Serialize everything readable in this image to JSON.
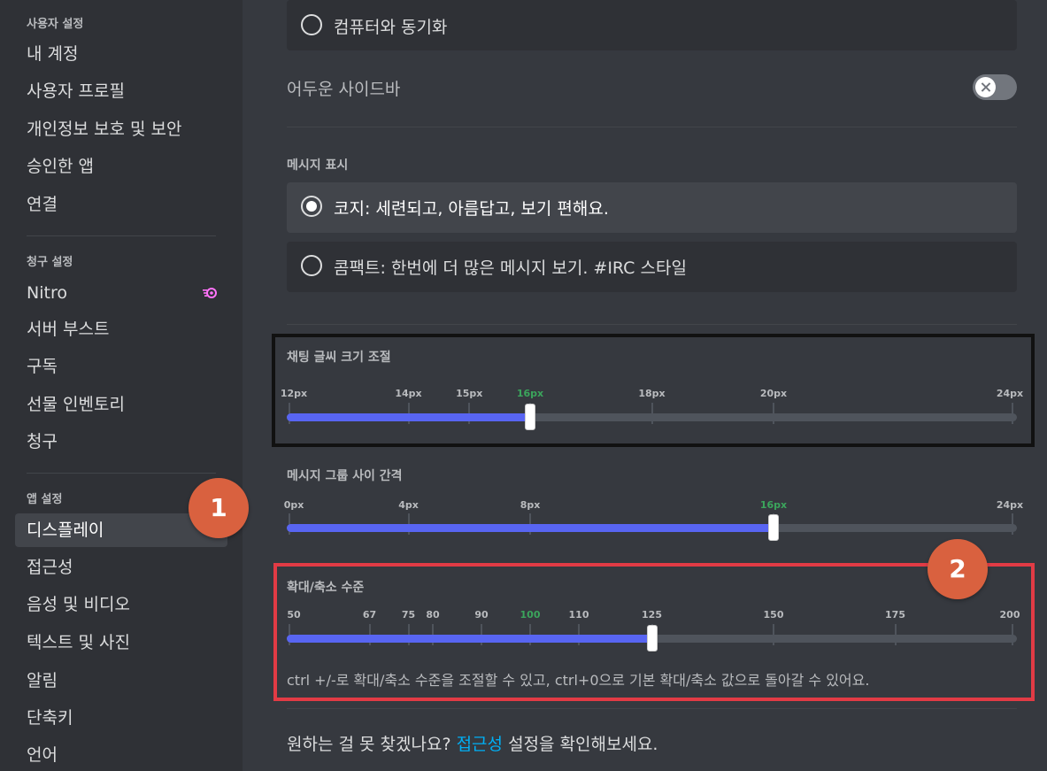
{
  "sidebar": {
    "user_settings_header": "사용자 설정",
    "user_items": [
      "내 계정",
      "사용자 프로필",
      "개인정보 보호 및 보안",
      "승인한 앱",
      "연결"
    ],
    "billing_header": "청구 설정",
    "billing_items": [
      "Nitro",
      "서버 부스트",
      "구독",
      "선물 인벤토리",
      "청구"
    ],
    "app_header": "앱 설정",
    "app_items": [
      "디스플레이",
      "접근성",
      "음성 및 비디오",
      "텍스트 및 사진",
      "알림",
      "단축키",
      "언어"
    ],
    "selected_item": "디스플레이",
    "nitro_icon": "nitro-boost-icon"
  },
  "main": {
    "sync_option": "컴퓨터와 동기화",
    "dark_sidebar_label": "어두운 사이드바",
    "dark_sidebar_enabled": false,
    "message_display_label": "메시지 표시",
    "cozy_option": "코지: 세련되고, 아름답고, 보기 편해요.",
    "compact_option": "콤팩트: 한번에 더 많은 메시지 보기. #IRC 스타일",
    "font_scaling": {
      "label": "채팅 글씨 크기 조절",
      "ticks": [
        "12px",
        "14px",
        "15px",
        "16px",
        "18px",
        "20px",
        "24px"
      ],
      "tick_values": [
        12,
        14,
        15,
        16,
        18,
        20,
        24
      ],
      "min": 12,
      "max": 24,
      "value": 16,
      "active_tick": "16px"
    },
    "message_spacing": {
      "label": "메시지 그룹 사이 간격",
      "ticks": [
        "0px",
        "4px",
        "8px",
        "16px",
        "24px"
      ],
      "tick_values": [
        0,
        4,
        8,
        16,
        24
      ],
      "min": 0,
      "max": 24,
      "value": 16,
      "active_tick": "16px"
    },
    "zoom_level": {
      "label": "확대/축소 수준",
      "ticks": [
        "50",
        "67",
        "75",
        "80",
        "90",
        "100",
        "110",
        "125",
        "150",
        "175",
        "200"
      ],
      "tick_values": [
        50,
        67,
        75,
        80,
        90,
        100,
        110,
        125,
        150,
        175,
        200
      ],
      "min": 50,
      "max": 200,
      "value": 125,
      "active_tick": "100",
      "hint": "ctrl +/-로 확대/축소 수준을 조절할 수 있고, ctrl+0으로 기본 확대/축소 값으로 돌아갈 수 있어요."
    },
    "footer": {
      "prefix": "원하는 걸 못 찾겠나요? ",
      "link": "접근성",
      "suffix": " 설정을 확인해보세요."
    }
  },
  "annotations": {
    "badge_1": "1",
    "badge_2": "2"
  },
  "colors": {
    "accent": "#5865f2",
    "active_tick": "#3ba55c",
    "badge": "#d9613f",
    "highlight_red": "#e23b45",
    "link": "#00aff4"
  }
}
